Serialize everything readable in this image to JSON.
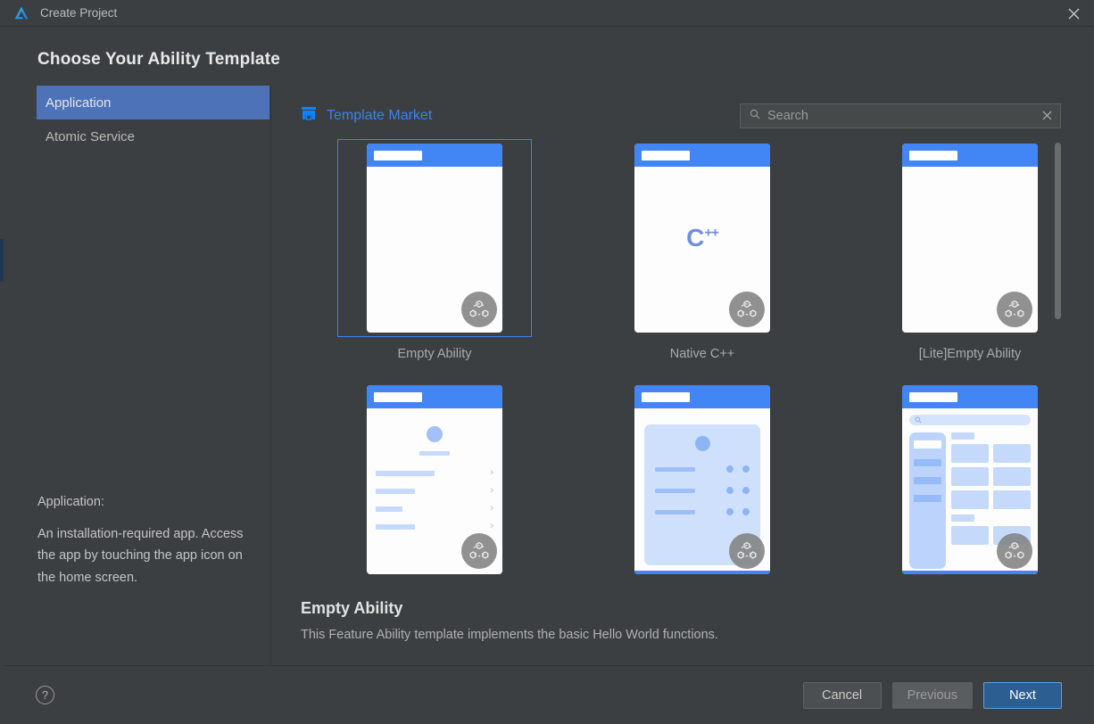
{
  "window": {
    "title": "Create Project",
    "logo_icon": "huawei-devEco-logo-icon",
    "close_icon": "close-icon"
  },
  "heading": "Choose Your Ability Template",
  "sidebar": {
    "items": [
      {
        "label": "Application",
        "selected": true
      },
      {
        "label": "Atomic Service",
        "selected": false
      }
    ],
    "description": {
      "label": "Application:",
      "text": "An installation-required app. Access the app by touching the app icon on the home screen."
    }
  },
  "main": {
    "template_market": {
      "label": "Template Market",
      "icon": "store-icon",
      "color": "#3c82f0"
    },
    "search": {
      "placeholder": "Search",
      "value": "",
      "icon": "search-icon",
      "clear_icon": "close-icon"
    },
    "cards": [
      {
        "label": "Empty Ability",
        "variant": "empty",
        "selected": true,
        "badge_icon": "distributed-ability-icon"
      },
      {
        "label": "Native C++",
        "variant": "cpp",
        "selected": false,
        "badge_icon": "distributed-ability-icon",
        "glyph": "C",
        "glyph_sup": "++"
      },
      {
        "label": "[Lite]Empty Ability",
        "variant": "empty",
        "selected": false,
        "badge_icon": "distributed-ability-icon"
      },
      {
        "label": "",
        "variant": "settings-list",
        "selected": false,
        "badge_icon": "distributed-ability-icon"
      },
      {
        "label": "",
        "variant": "panel-card",
        "selected": false,
        "badge_icon": "distributed-ability-icon"
      },
      {
        "label": "",
        "variant": "category-grid",
        "selected": false,
        "badge_icon": "distributed-ability-icon"
      }
    ],
    "detail": {
      "title": "Empty Ability",
      "description": "This Feature Ability template implements the basic Hello World functions."
    }
  },
  "footer": {
    "help_icon": "help-icon",
    "help_label": "?",
    "buttons": [
      {
        "label": "Cancel",
        "style": "cancel"
      },
      {
        "label": "Previous",
        "style": "previous"
      },
      {
        "label": "Next",
        "style": "next"
      }
    ]
  },
  "colors": {
    "background": "#3c3f41",
    "accent_blue": "#4285f4",
    "selection_blue": "#4d72b8",
    "primary_button": "#2d5e92"
  }
}
